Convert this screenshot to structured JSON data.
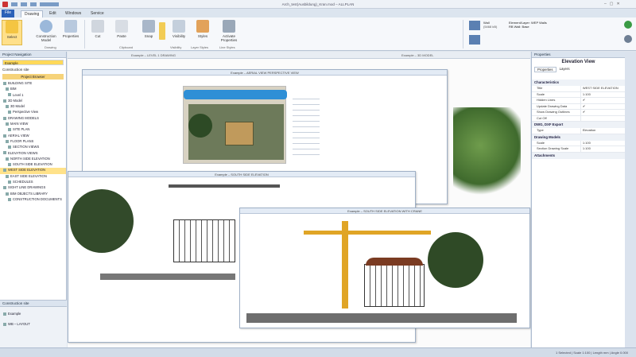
{
  "window": {
    "title": "Arch_test(Ausbildung)_Kran.mod – ALLPLAN"
  },
  "tabs": [
    {
      "label": "File"
    },
    {
      "label": "Drawing"
    },
    {
      "label": "Edit"
    },
    {
      "label": "Windows"
    },
    {
      "label": "Service"
    }
  ],
  "ribbon": {
    "buttons": [
      {
        "label": "Select"
      },
      {
        "label": "Construction Model"
      },
      {
        "label": "Properties"
      },
      {
        "label": "Cut"
      },
      {
        "label": "Paste"
      },
      {
        "label": "Snap"
      },
      {
        "label": "Visibility"
      },
      {
        "label": "Styles"
      },
      {
        "label": "Activate Properties"
      }
    ],
    "groups": [
      {
        "label": "Drawing"
      },
      {
        "label": "Clipboard"
      },
      {
        "label": "Visibility"
      },
      {
        "label": "Layer Styles"
      },
      {
        "label": "Line Styles"
      }
    ],
    "info": {
      "a": "Wall",
      "b": "(5468 kB)",
      "c": "Element/Layer: WEP Walls",
      "d": "RB Wall: Base"
    }
  },
  "left_panel": {
    "title": "Project Navigation",
    "search": "Example",
    "subtitle": "Construction site",
    "header": "Project Browser",
    "tree": [
      {
        "label": "BUILDING SITE"
      },
      {
        "label": "BIM"
      },
      {
        "label": "Level 1"
      },
      {
        "label": "3D Model"
      },
      {
        "label": "3D Model"
      },
      {
        "label": "Perspective View"
      },
      {
        "label": "DRAWING MODELS"
      },
      {
        "label": "MAIN VIEW"
      },
      {
        "label": "SITE PLAN"
      },
      {
        "label": "AERIAL VIEW"
      },
      {
        "label": "FLOOR PLANS"
      },
      {
        "label": "SECTION VIEWS"
      },
      {
        "label": "ELEVATION VIEWS"
      },
      {
        "label": "NORTH SIDE ELEVATION"
      },
      {
        "label": "SOUTH SIDE ELEVATION"
      },
      {
        "label": "WEST SIDE ELEVATION"
      },
      {
        "label": "EAST SIDE ELEVATION"
      },
      {
        "label": "SCHEDULES"
      },
      {
        "label": "SIGHT LINE DRAWINGS"
      },
      {
        "label": "BIM OBJECTS LIBRARY"
      },
      {
        "label": "CONSTRUCTION DOCUMENTS"
      }
    ],
    "bottom": [
      {
        "label": "Construction site"
      },
      {
        "label": "Example"
      },
      {
        "label": "WB – LAYOUT"
      }
    ]
  },
  "windows": [
    {
      "title": "Example – LEVEL 1 DRAWING"
    },
    {
      "title": "Example – AERIAL VIEW PERSPECTIVE VIEW"
    },
    {
      "title": "Example – SOUTH SIDE ELEVATION"
    },
    {
      "title": "Example – SOUTH SIDE ELEVATION WITH CRANE"
    },
    {
      "title": "Example – 3D MODEL"
    }
  ],
  "right_panel": {
    "title": "Properties",
    "heading": "Elevation View",
    "tabs": [
      {
        "label": "Properties"
      },
      {
        "label": "Layers"
      }
    ],
    "sections": [
      {
        "title": "Characteristics",
        "props": [
          [
            "Title",
            "WEST SIDE ELEVATION"
          ],
          [
            "Scale",
            "1:100"
          ],
          [
            "Hidden Lines",
            "✔"
          ],
          [
            "Update Drawing Data",
            "✔"
          ],
          [
            "Show Drawing Outlines",
            "✔"
          ],
          [
            "Cut Off",
            ""
          ]
        ]
      },
      {
        "title": "DWG, DXF Export",
        "props": [
          [
            "Type",
            "Elevation"
          ]
        ]
      },
      {
        "title": "Drawing Models",
        "props": [
          [
            "Scale",
            "1:100"
          ],
          [
            "Section Drawing Scale",
            "1:100"
          ]
        ]
      },
      {
        "title": "Attachments",
        "props": []
      }
    ]
  },
  "status": {
    "text": "1 Selected  |  Scale 1:100  |  Length mm  |  Angle 0.000"
  }
}
